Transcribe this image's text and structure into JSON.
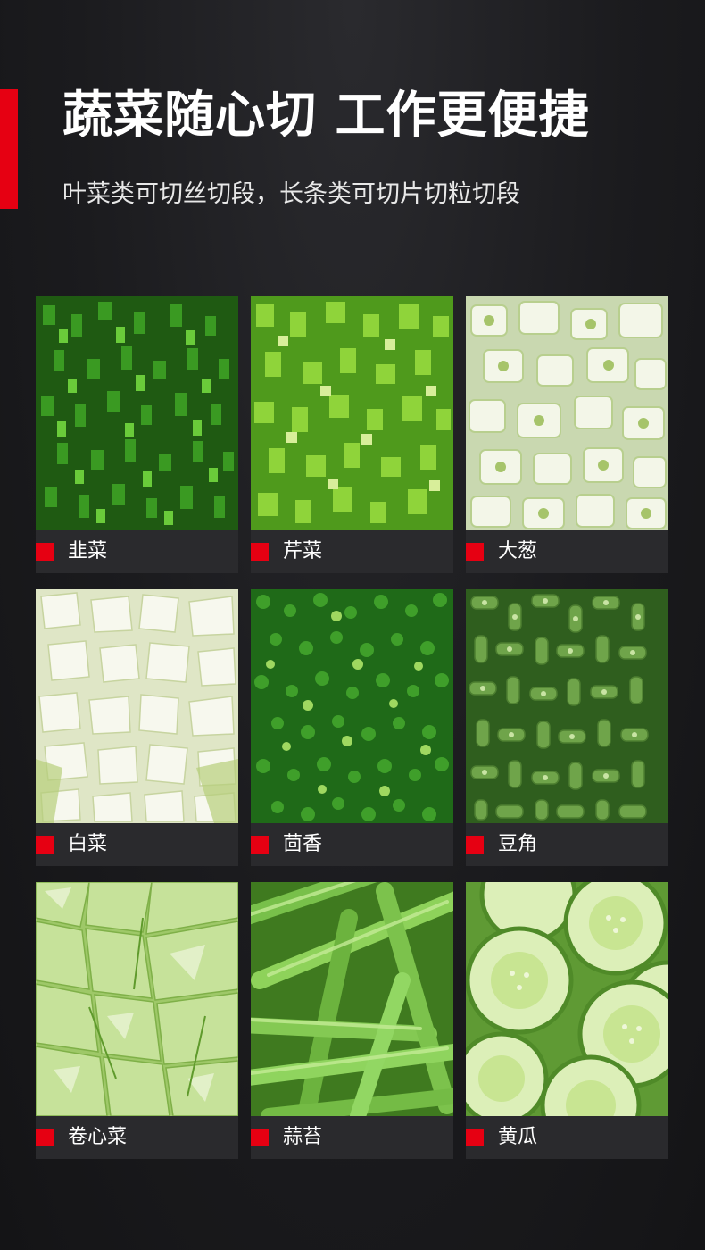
{
  "header": {
    "title": "蔬菜随心切 工作更便捷",
    "subtitle": "叶菜类可切丝切段，长条类可切片切粒切段"
  },
  "colors": {
    "accent": "#e60012",
    "background": "#1b1b1e",
    "card_label_bg": "#2a2a2d"
  },
  "items": [
    {
      "label": "韭菜",
      "image": "chopped-chives-photo"
    },
    {
      "label": "芹菜",
      "image": "chopped-celery-photo"
    },
    {
      "label": "大葱",
      "image": "sliced-leek-photo"
    },
    {
      "label": "白菜",
      "image": "diced-chinese-cabbage-photo"
    },
    {
      "label": "茴香",
      "image": "chopped-fennel-photo"
    },
    {
      "label": "豆角",
      "image": "cut-green-beans-photo"
    },
    {
      "label": "卷心菜",
      "image": "sliced-cabbage-photo"
    },
    {
      "label": "蒜苔",
      "image": "garlic-scapes-photo"
    },
    {
      "label": "黄瓜",
      "image": "sliced-cucumber-photo"
    }
  ]
}
